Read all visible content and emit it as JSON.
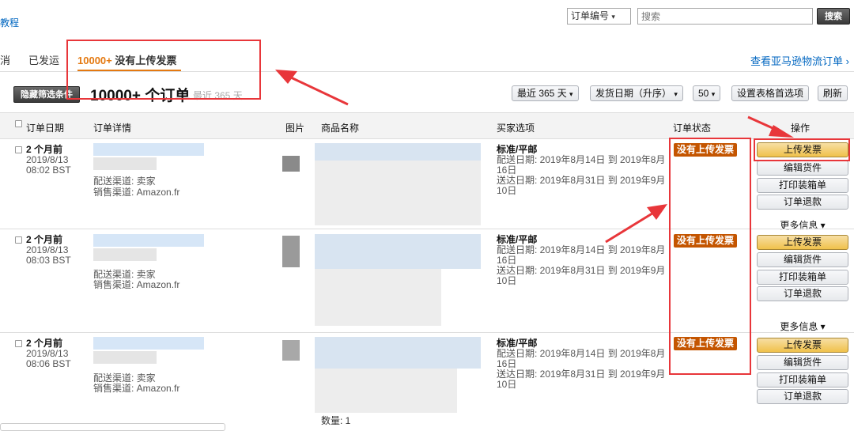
{
  "top": {
    "left_link": "教程",
    "search_select": "订单编号",
    "search_placeholder": "搜索",
    "search_button": "搜索"
  },
  "tabs": {
    "cancelled_partial": "消",
    "shipped": "已发运",
    "no_invoice_count": "10000+",
    "no_invoice_label": "没有上传发票",
    "fba_link": "查看亚马逊物流订单 ›"
  },
  "toolbar": {
    "hide_filters": "隐藏筛选条件",
    "count": "10000+ 个订单",
    "range_note": "最近 365 天",
    "range_select": "最近 365 天",
    "sort_select": "发货日期（升序）",
    "per_page_select": "50",
    "table_prefs": "设置表格首选项",
    "refresh": "刷新"
  },
  "columns": {
    "order_date": "订单日期",
    "order_details": "订单详情",
    "image": "图片",
    "product_name": "商品名称",
    "buyer_options": "买家选项",
    "order_status": "订单状态",
    "actions": "操作"
  },
  "orders": [
    {
      "age": "2 个月前",
      "date": "2019/8/13",
      "time": "08:02 BST",
      "channel": "配送渠道: 卖家",
      "sales": "销售渠道: Amazon.fr",
      "shipping": "标准/平邮",
      "ship_line1": "配送日期: 2019年8月14日 到 2019年8月",
      "ship_line2": "16日",
      "deliv_line1": "送达日期: 2019年8月31日 到 2019年9月",
      "deliv_line2": "10日",
      "status": "没有上传发票"
    },
    {
      "age": "2 个月前",
      "date": "2019/8/13",
      "time": "08:03 BST",
      "channel": "配送渠道: 卖家",
      "sales": "销售渠道: Amazon.fr",
      "shipping": "标准/平邮",
      "ship_line1": "配送日期: 2019年8月14日 到 2019年8月",
      "ship_line2": "16日",
      "deliv_line1": "送达日期: 2019年8月31日 到 2019年9月",
      "deliv_line2": "10日",
      "status": "没有上传发票"
    },
    {
      "age": "2 个月前",
      "date": "2019/8/13",
      "time": "08:06 BST",
      "channel": "配送渠道: 卖家",
      "sales": "销售渠道: Amazon.fr",
      "shipping": "标准/平邮",
      "ship_line1": "配送日期: 2019年8月14日 到 2019年8月",
      "ship_line2": "16日",
      "deliv_line1": "送达日期: 2019年8月31日 到 2019年9月",
      "deliv_line2": "10日",
      "status": "没有上传发票"
    }
  ],
  "actions": {
    "upload_invoice": "上传发票",
    "edit_shipment": "编辑货件",
    "print_packing": "打印装箱单",
    "refund": "订单退款",
    "more_info": "更多信息 ▾"
  },
  "quantity": "数量: 1",
  "colors": {
    "status_badge": "#c45500",
    "primary_button": "#f0c14b",
    "tab_active": "#e47911",
    "annotation": "#e8363a"
  }
}
